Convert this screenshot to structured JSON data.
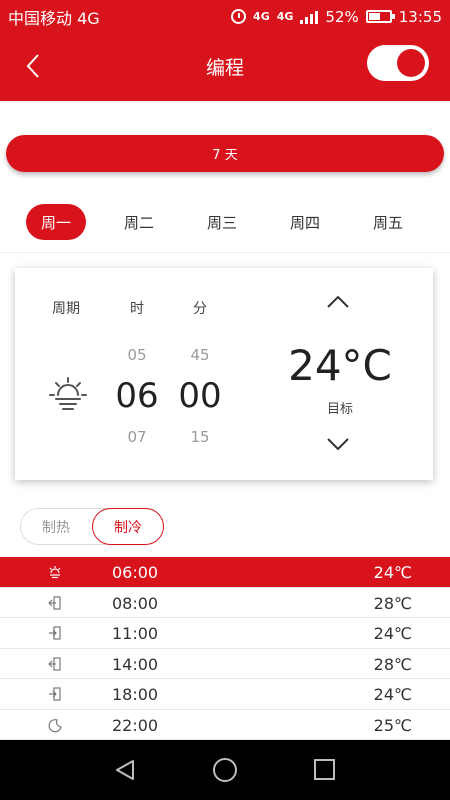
{
  "status_bar": {
    "carrier": "中国移动 4G",
    "net1": "4G",
    "net2": "4G",
    "battery": "52%",
    "time": "13:55"
  },
  "header": {
    "title": "编程",
    "back_icon": "chevron-left-icon",
    "toggle_on": true
  },
  "days_pill": "7 天",
  "weekdays": [
    {
      "label": "周一",
      "active": true
    },
    {
      "label": "周二",
      "active": false
    },
    {
      "label": "周三",
      "active": false
    },
    {
      "label": "周四",
      "active": false
    },
    {
      "label": "周五",
      "active": false
    }
  ],
  "editor": {
    "period_label": "周期",
    "hour_label": "时",
    "minute_label": "分",
    "hour_prev": "05",
    "hour_current": "06",
    "hour_next": "07",
    "minute_prev": "45",
    "minute_current": "00",
    "minute_next": "15",
    "target_temp": "24°C",
    "target_label": "目标",
    "period_icon": "sunrise-icon"
  },
  "modes": {
    "heat": "制热",
    "cool": "制冷",
    "selected": "cool"
  },
  "schedule": [
    {
      "time": "06:00",
      "temp": "24℃",
      "icon": "sunrise-icon",
      "active": true
    },
    {
      "time": "08:00",
      "temp": "28℃",
      "icon": "leave-home-icon",
      "active": false
    },
    {
      "time": "11:00",
      "temp": "24℃",
      "icon": "return-home-icon",
      "active": false
    },
    {
      "time": "14:00",
      "temp": "28℃",
      "icon": "leave-home-icon",
      "active": false
    },
    {
      "time": "18:00",
      "temp": "24℃",
      "icon": "return-home-icon",
      "active": false
    },
    {
      "time": "22:00",
      "temp": "25℃",
      "icon": "moon-icon",
      "active": false
    }
  ],
  "colors": {
    "accent": "#d9131b",
    "text": "#333333",
    "muted": "#999999"
  }
}
